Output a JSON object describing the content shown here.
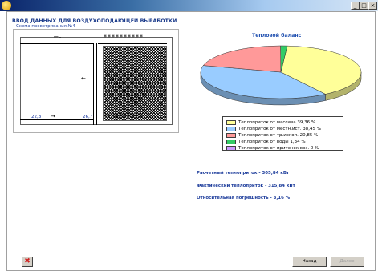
{
  "window": {
    "title": "ВВОД ДАННЫХ ДЛЯ ВОЗДУХОПОДАЮЩЕЙ ВЫРАБОТКИ",
    "min_glyph": "_",
    "max_glyph": "□",
    "close_glyph": "×"
  },
  "scheme": {
    "label": "Схема проветривания №4",
    "top_arrow": "←–",
    "top_right_value": "**********",
    "middle_arrow": "←",
    "bottom_left_value": "22,8",
    "bottom_arrow": "→",
    "bottom_mid_value": "26,7",
    "bottom_right_value": "**********"
  },
  "chart_data": {
    "type": "pie",
    "title": "Тепловой баланс",
    "labels": [
      "Теплоприток от массива 39,36 %",
      "Теплоприток от местн.ист. 38,45 %",
      "Теплоприток от тр.ископ. 20,85 %",
      "Теплоприток от воды 1,34 %",
      "Теплоприток от притечек воз. 0 %"
    ],
    "values": [
      39.36,
      38.45,
      20.85,
      1.34,
      0
    ],
    "colors": [
      "#ffff99",
      "#99ccff",
      "#ff9999",
      "#33cc66",
      "#cc99ff"
    ],
    "side_colors": [
      "#b3b36b",
      "#6b8fb3",
      "#b36b6b",
      "#1f8a45",
      "#8f6bb3"
    ]
  },
  "results": {
    "calc": "Расчетный теплоприток - 305,84 кВт",
    "fact": "Фактический теплоприток - 315,84 кВт",
    "error": "Относительная погрешность - 3,16 %"
  },
  "buttons": {
    "close": "✖",
    "back": "Назад",
    "next": "Далее"
  }
}
